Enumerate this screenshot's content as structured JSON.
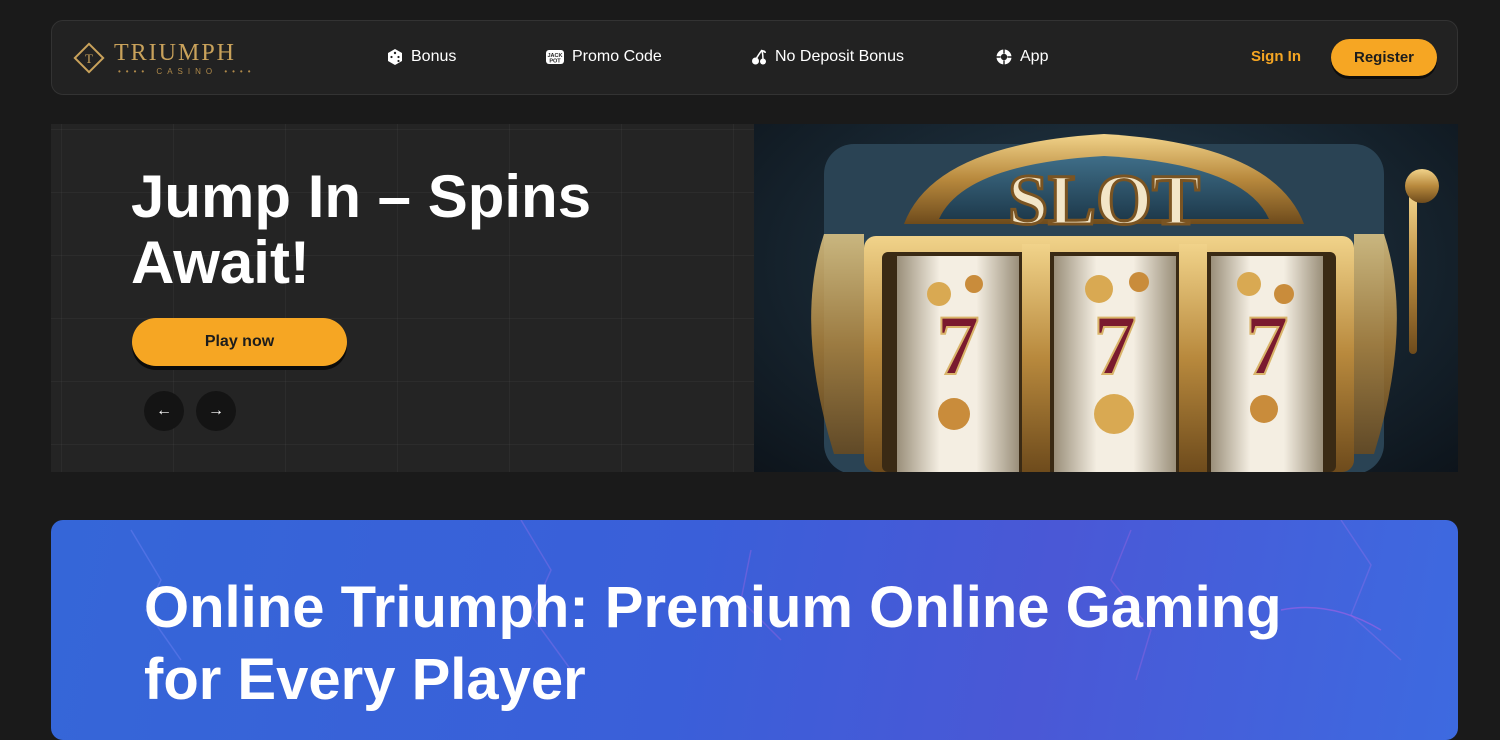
{
  "brand": {
    "name": "TRIUMPH",
    "subtitle": "•••• CASINO ••••",
    "colors": {
      "gold": "#c9a25b",
      "accent": "#f6a623",
      "banner_blue": "#3a62d9",
      "bg": "#1a1a1a"
    }
  },
  "nav": {
    "items": [
      {
        "label": "Bonus",
        "icon": "dice-icon"
      },
      {
        "label": "Promo Code",
        "icon": "jackpot-icon"
      },
      {
        "label": "No Deposit Bonus",
        "icon": "cherry-icon"
      },
      {
        "label": "App",
        "icon": "app-icon"
      }
    ],
    "sign_in": "Sign In",
    "register": "Register"
  },
  "hero": {
    "title": "Jump In – Spins Await!",
    "play_label": "Play now",
    "prev_icon": "←",
    "next_icon": "→",
    "image": {
      "subject": "ornate slot machine",
      "sign_text": "SLOT",
      "reel_symbols": [
        "7",
        "7",
        "7"
      ]
    }
  },
  "banner": {
    "title": "Online Triumph: Premium Online Gaming for Every Player"
  }
}
